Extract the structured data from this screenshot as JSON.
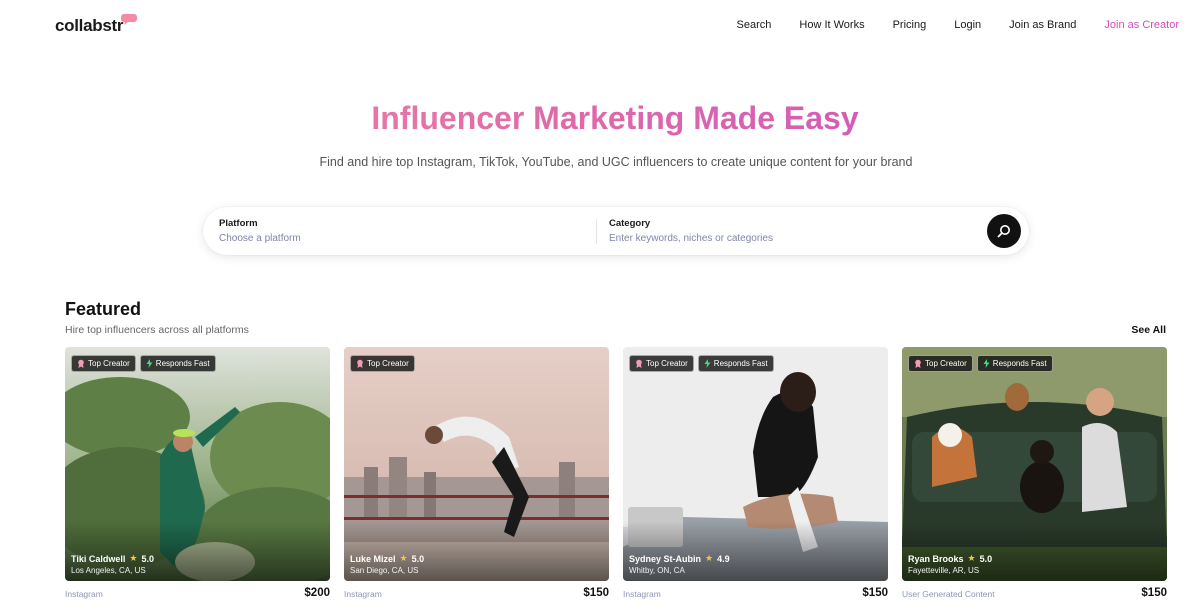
{
  "brand": {
    "name": "collabstr"
  },
  "nav": {
    "items": [
      {
        "label": "Search"
      },
      {
        "label": "How It Works"
      },
      {
        "label": "Pricing"
      },
      {
        "label": "Login"
      },
      {
        "label": "Join as Brand"
      },
      {
        "label": "Join as Creator"
      }
    ]
  },
  "hero": {
    "title": "Influencer Marketing Made Easy",
    "subtitle": "Find and hire top Instagram, TikTok, YouTube, and UGC influencers to create unique content for your brand"
  },
  "search": {
    "platform_label": "Platform",
    "platform_placeholder": "Choose a platform",
    "category_label": "Category",
    "category_placeholder": "Enter keywords, niches or categories"
  },
  "featured": {
    "title": "Featured",
    "subtitle": "Hire top influencers across all platforms",
    "see_all": "See All",
    "cards": [
      {
        "badge_top": "Top Creator",
        "badge_fast": "Responds Fast",
        "name": "Tiki Caldwell",
        "rating": "5.0",
        "location": "Los Angeles, CA, US",
        "platform": "Instagram",
        "price": "$200"
      },
      {
        "badge_top": "Top Creator",
        "name": "Luke Mizel",
        "rating": "5.0",
        "location": "San Diego, CA, US",
        "platform": "Instagram",
        "price": "$150"
      },
      {
        "badge_top": "Top Creator",
        "badge_fast": "Responds Fast",
        "name": "Sydney St-Aubin",
        "rating": "4.9",
        "location": "Whitby, ON, CA",
        "platform": "Instagram",
        "price": "$150"
      },
      {
        "badge_top": "Top Creator",
        "badge_fast": "Responds Fast",
        "name": "Ryan Brooks",
        "rating": "5.0",
        "location": "Fayetteville, AR, US",
        "platform": "User Generated Content",
        "price": "$150"
      }
    ]
  },
  "colors": {
    "accent": "#d24dc1",
    "gradient_start": "#f78da7",
    "gradient_end": "#c44cc8",
    "star": "#f5c542",
    "muted_link": "#8e96b5"
  },
  "icons": {
    "logo_bubble": "speech-bubble-icon",
    "search": "search-icon",
    "top_creator": "award-icon",
    "responds_fast": "lightning-icon",
    "rating": "star-icon"
  }
}
